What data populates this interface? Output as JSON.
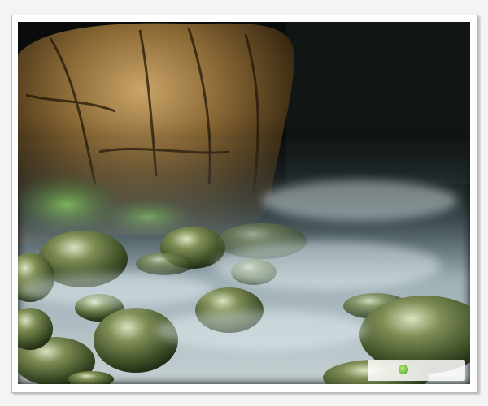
{
  "image": {
    "subject": "",
    "palette": {
      "mist": "#cfe6ee",
      "stone": "#7a6a3a",
      "moss": "#5a8f2a",
      "dark": "#0a0c0b"
    }
  },
  "watermark": {
    "script": "",
    "line1": "",
    "line2": ""
  }
}
